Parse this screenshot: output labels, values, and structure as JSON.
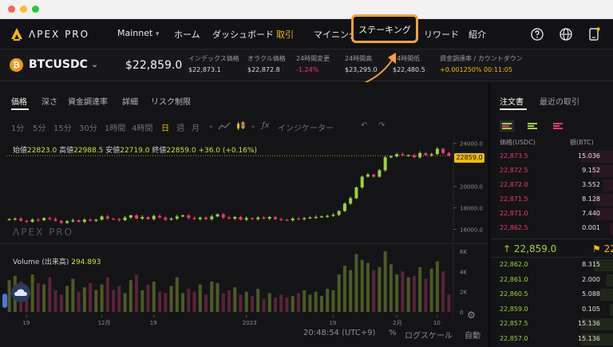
{
  "nav": {
    "brand": "ΛPEX PRO",
    "items": [
      "Mainnet",
      "ホーム",
      "ダッシュボード",
      "取引",
      "マイニング",
      "ステーキング",
      "リワード",
      "紹介"
    ],
    "network_chevron": "▾"
  },
  "ticker": {
    "symbol": "BTCUSDC",
    "price": "$22,859.0",
    "stats": [
      {
        "label": "インデックス価格",
        "value": "$22,873.1"
      },
      {
        "label": "オラクル価格",
        "value": "$22,872.8"
      },
      {
        "label": "24時間変更",
        "value": "-1.24%"
      },
      {
        "label": "24時間高",
        "value": "$23,295.0"
      },
      {
        "label": "24時間低",
        "value": "$22,480.5"
      },
      {
        "label": "資金調達率 / カウントダウン",
        "value": "+0.001250% 00:11:05"
      }
    ]
  },
  "chart": {
    "tabs": [
      "価格",
      "深さ",
      "資金調達率",
      "詳細",
      "リスク制限"
    ],
    "intervals": [
      "1分",
      "5分",
      "15分",
      "30分",
      "1時間",
      "4時間",
      "日",
      "週",
      "月"
    ],
    "indicator_label": "インジケーター",
    "ohlc": {
      "open_label": "始値",
      "open": "22823.0",
      "high_label": "高値",
      "high": "22988.5",
      "low_label": "安値",
      "low": "22719.0",
      "close_label": "終値",
      "close": "22859.0",
      "change": "+36.0 (+0.16%)"
    },
    "watermark": "ΛPEX PRO",
    "volume_label": "Volume (出来高)",
    "volume_value": "294.893",
    "current_price_tag": "22859.0",
    "price_axis": [
      "24000.0",
      "20000.0",
      "18000.0",
      "16000.0"
    ],
    "volume_axis": [
      "6K",
      "4K",
      "2K",
      "0"
    ],
    "time_axis": [
      "19",
      "12月",
      "19",
      "2023",
      "19",
      "2月",
      "10"
    ],
    "footer_time": "20:48:54 (UTC+9)",
    "footer_options": [
      "%",
      "ログスケール",
      "自動"
    ]
  },
  "chart_data": {
    "type": "candlestick",
    "symbol": "BTCUSDC",
    "interval": "日",
    "ylim": [
      15000,
      24500
    ],
    "closes": [
      16950,
      17000,
      16800,
      16700,
      16900,
      16850,
      17050,
      16950,
      16800,
      16600,
      16750,
      16850,
      16700,
      16900,
      16800,
      16900,
      17200,
      17000,
      16950,
      16850,
      17100,
      17300,
      17000,
      17150,
      16950,
      17250,
      17100,
      16900,
      17000,
      17200,
      17300,
      17050,
      16950,
      17100,
      16950,
      17200,
      17400,
      17100,
      17000,
      17150,
      16900,
      17050,
      16950,
      17100,
      17000,
      17150,
      16950,
      16900,
      16850,
      17000,
      16950,
      17050,
      17100,
      17150,
      17200,
      17250,
      17350,
      17700,
      18400,
      18900,
      19900,
      20900,
      21100,
      20900,
      21500,
      22700,
      22800,
      23000,
      22900,
      22900,
      22700,
      23100,
      22900,
      23000,
      23500,
      23100,
      22859
    ],
    "volume_series": [
      2200,
      2500,
      2100,
      1600,
      2600,
      2000,
      1900,
      2400,
      1500,
      1200,
      1800,
      2300,
      1400,
      1700,
      2000,
      1500,
      1900,
      2400,
      1500,
      1800,
      1300,
      2200,
      2600,
      1500,
      1900,
      2100,
      1400,
      1300,
      1800,
      2400,
      1300,
      1600,
      1400,
      1900,
      1200,
      2100,
      2000,
      1300,
      1500,
      1700,
      1200,
      1400,
      1100,
      1600,
      900,
      1300,
      1000,
      1200,
      1000,
      1100,
      1300,
      1500,
      1200,
      1400,
      1100,
      1600,
      1500,
      2600,
      3200,
      2900,
      4000,
      3600,
      3400,
      2900,
      3100,
      4200,
      3300,
      2600,
      2800,
      2400,
      2500,
      3100,
      2300,
      3000,
      3500,
      2800,
      1200
    ]
  },
  "orderbook": {
    "tabs": [
      "注文書",
      "最近の取引"
    ],
    "headers": [
      "価格(USDC)",
      "額(BTC)"
    ],
    "asks": [
      {
        "price": "22,873.5",
        "qty": "15.036"
      },
      {
        "price": "22,872.5",
        "qty": "9.152"
      },
      {
        "price": "22,872.0",
        "qty": "3.552"
      },
      {
        "price": "22,871.5",
        "qty": "8.128"
      },
      {
        "price": "22,871.0",
        "qty": "7.440"
      },
      {
        "price": "22,862.5",
        "qty": "0.001"
      }
    ],
    "mid_price": "↑ 22,859.0",
    "mid_flag": "⚑ 22",
    "bids": [
      {
        "price": "22,862.0",
        "qty": "8.315"
      },
      {
        "price": "22,861.0",
        "qty": "2.000"
      },
      {
        "price": "22,860.5",
        "qty": "5.088"
      },
      {
        "price": "22,859.0",
        "qty": "0.105"
      },
      {
        "price": "22,857.5",
        "qty": "15.136"
      },
      {
        "price": "22,857.0",
        "qty": "15.136"
      }
    ]
  },
  "colors": {
    "accent": "#f0b90b",
    "up": "#9cd23b",
    "down": "#f0386b",
    "highlight": "#f3a23a"
  }
}
